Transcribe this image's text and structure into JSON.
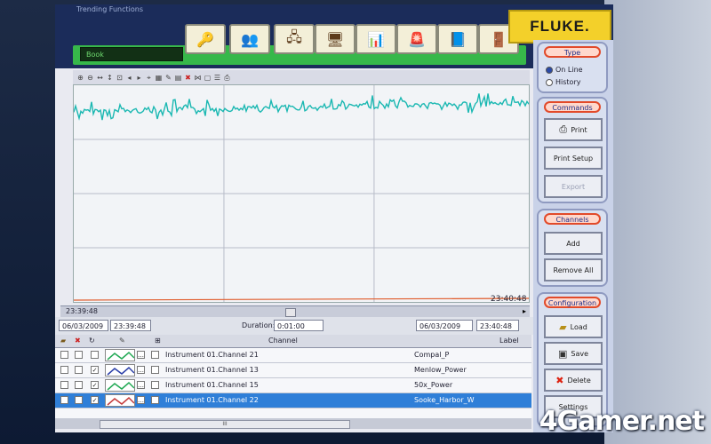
{
  "app": {
    "title_strip": "Trending Functions",
    "mode_label": "Book",
    "brand": "FLUKE."
  },
  "toolbar": {
    "buttons": [
      {
        "icon": "key-icon",
        "glyph": "🔑"
      },
      {
        "icon": "users-icon",
        "glyph": "👥"
      },
      {
        "icon": "network-icon",
        "glyph": "🖧"
      },
      {
        "icon": "computer-icon",
        "glyph": "🖥"
      },
      {
        "icon": "bar-chart-icon",
        "glyph": "📊"
      },
      {
        "icon": "alarm-icon",
        "glyph": "🚨"
      },
      {
        "icon": "book-icon",
        "glyph": "📘"
      },
      {
        "icon": "exit-icon",
        "glyph": "🚪"
      }
    ]
  },
  "chart": {
    "start_time": "23:39:48",
    "end_time": "23:40:48",
    "line_color": "#1bb8b2",
    "bottom_trace_color": "#e05a2a"
  },
  "controls": {
    "start_date": "06/03/2009",
    "start_time": "23:39:48",
    "duration_label": "Duration:",
    "duration_value": "0:01:00",
    "end_date": "06/03/2009",
    "end_time": "23:40:48"
  },
  "table": {
    "col_channel": "Channel",
    "col_label": "Label",
    "rows": [
      {
        "channel": "Instrument 01.Channel 21",
        "label": "Compal_P",
        "color": "#22aa55",
        "checked": false
      },
      {
        "channel": "Instrument 01.Channel 13",
        "label": "Menlow_Power",
        "color": "#2a3ea8",
        "checked": true
      },
      {
        "channel": "Instrument 01.Channel 15",
        "label": "50x_Power",
        "color": "#22aa55",
        "checked": true
      },
      {
        "channel": "Instrument 01.Channel 22",
        "label": "Sooke_Harbor_W",
        "color": "#c43a3a",
        "checked": true,
        "selected": true
      }
    ],
    "scroll_label": "III"
  },
  "panel": {
    "type": {
      "title": "Type",
      "options": [
        "On Line",
        "History"
      ],
      "selected": "On Line"
    },
    "commands": {
      "title": "Commands",
      "buttons": [
        "Print",
        "Print Setup",
        "Export"
      ]
    },
    "channels": {
      "title": "Channels",
      "buttons": [
        "Add",
        "Remove All"
      ]
    },
    "configuration": {
      "title": "Configuration",
      "buttons": [
        "Load",
        "Save",
        "Delete",
        "Settings"
      ]
    }
  },
  "watermark": "4Gamer.net"
}
